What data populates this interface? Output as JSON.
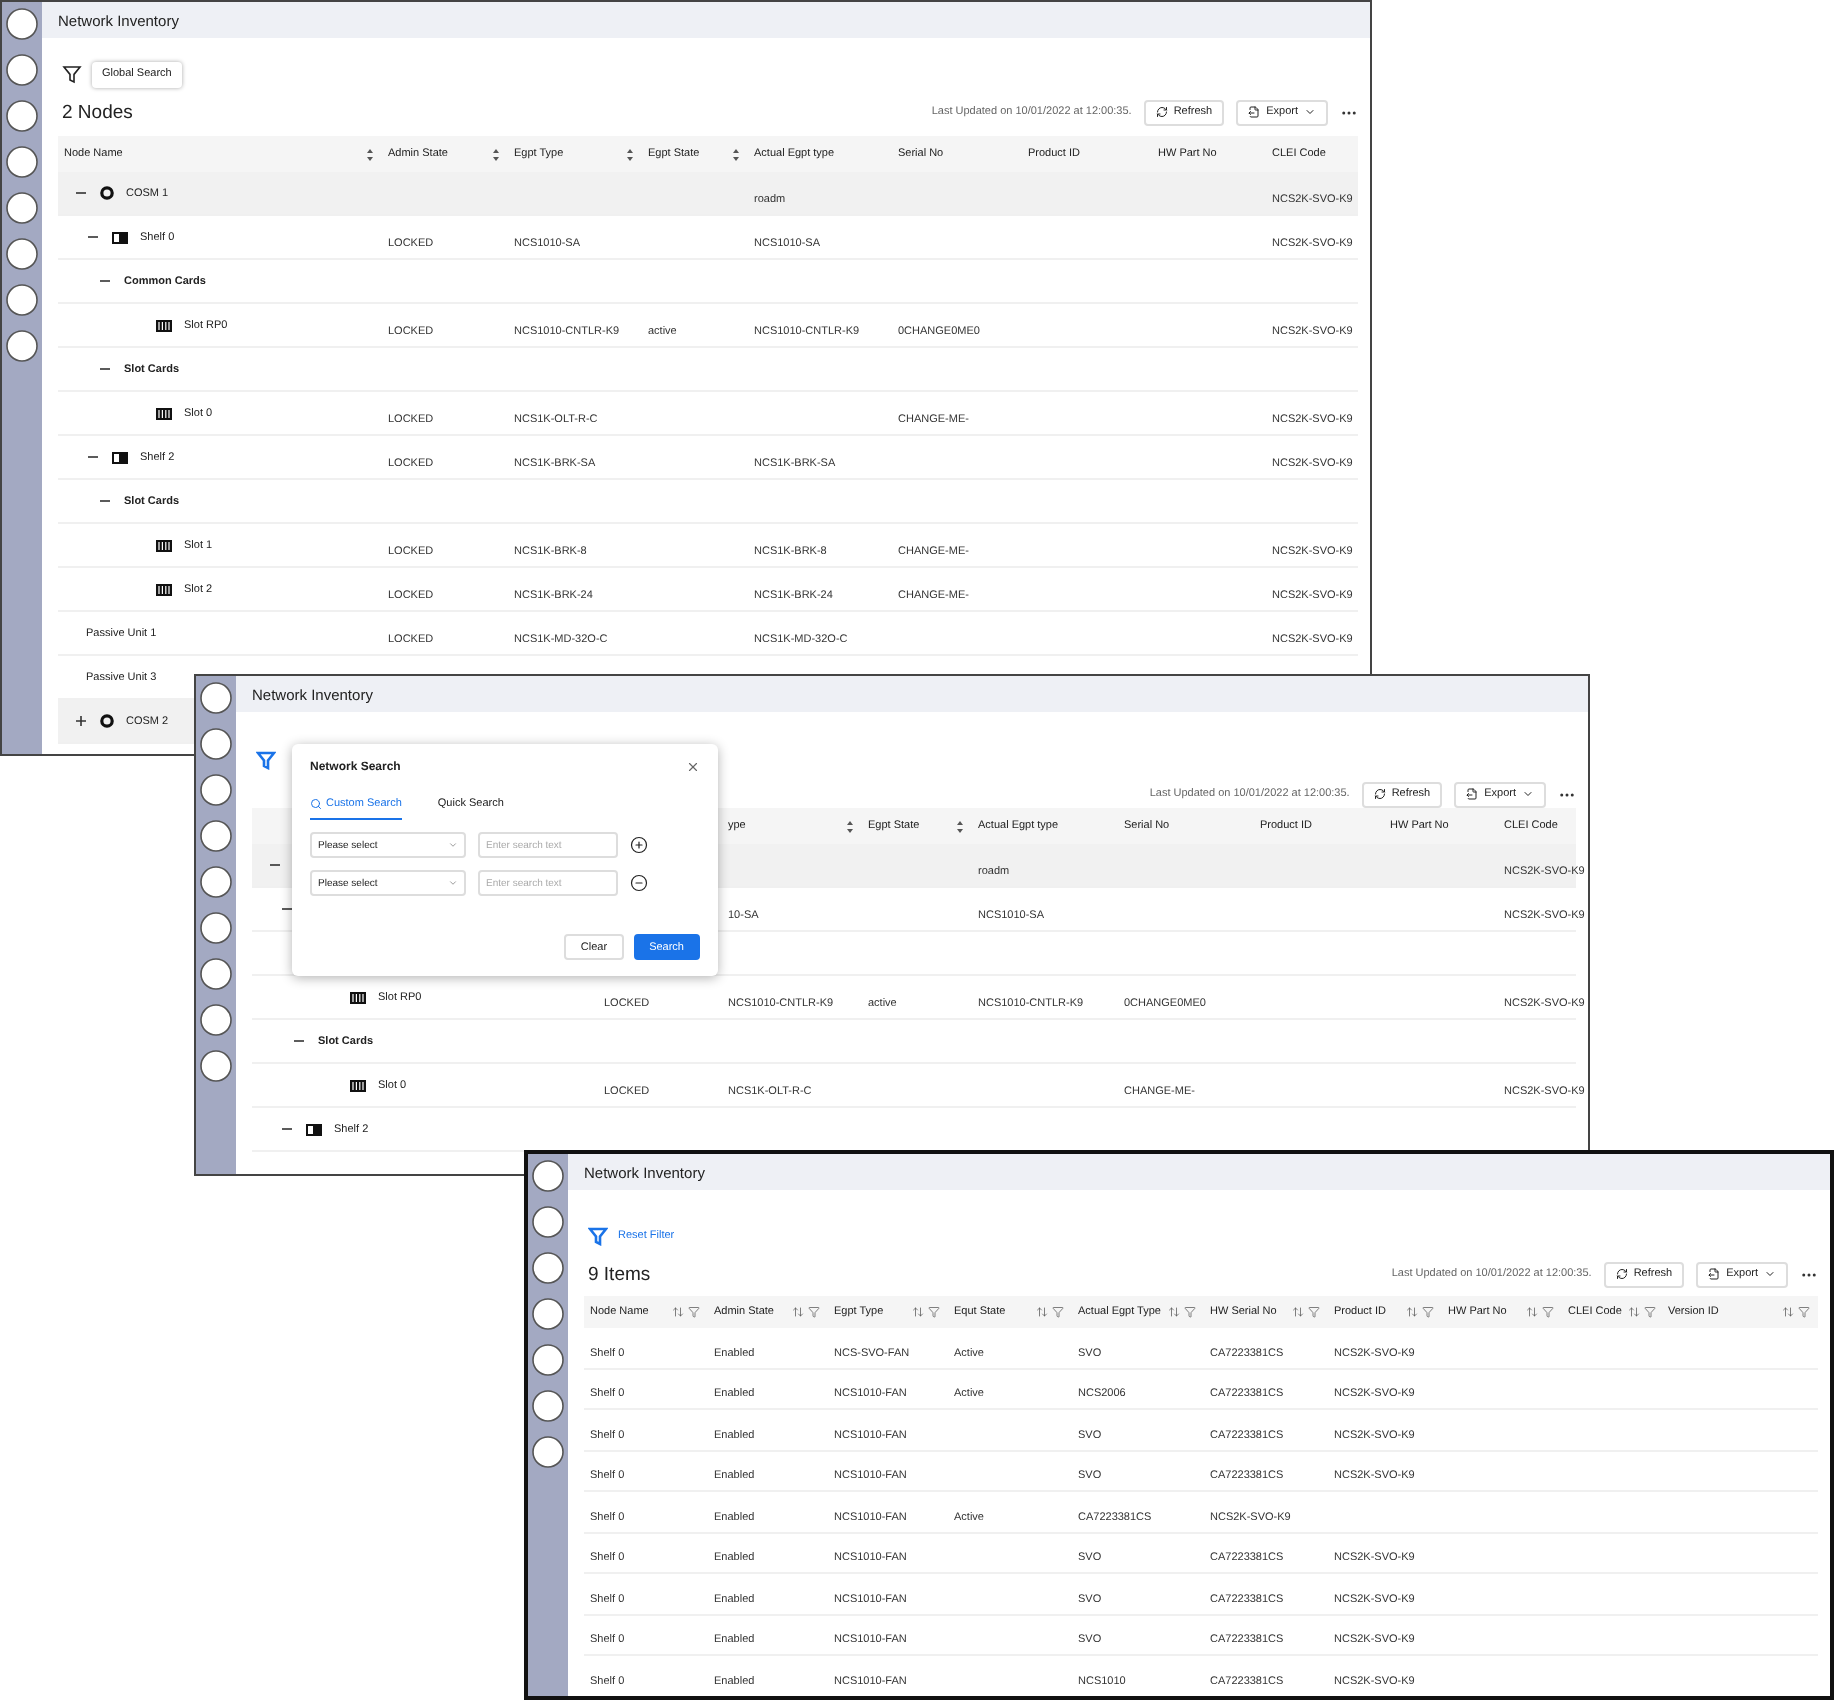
{
  "windows": [
    {
      "kind": "tree",
      "title": "Network Inventory",
      "filter_active": false,
      "filter_action": {
        "kind": "button",
        "label": "Global Search"
      },
      "count": "2 Nodes",
      "last_updated": "Last Updated on 10/01/2022 at 12:00:35.",
      "refresh": "Refresh",
      "export": "Export",
      "columns": [
        {
          "label": "Node Name",
          "sortable": true
        },
        {
          "label": "Admin State",
          "sortable": true
        },
        {
          "label": "Egpt Type",
          "sortable": true
        },
        {
          "label": "Egpt State",
          "sortable": true
        },
        {
          "label": "Actual Egpt type",
          "sortable": false
        },
        {
          "label": "Serial No",
          "sortable": false
        },
        {
          "label": "Product ID",
          "sortable": false
        },
        {
          "label": "HW Part No",
          "sortable": false
        },
        {
          "label": "CLEI Code",
          "sortable": false
        }
      ],
      "rows": [
        {
          "kind": "cosm",
          "name": "COSM 1",
          "expanded": true,
          "cells": [
            null,
            null,
            null,
            null,
            "roadm",
            null,
            null,
            null,
            "NCS2K-SVO-K9"
          ],
          "children": [
            {
              "kind": "shelf",
              "name": "Shelf 0",
              "expanded": true,
              "cells": [
                null,
                "LOCKED",
                "NCS1010-SA",
                null,
                "NCS1010-SA",
                null,
                null,
                null,
                "NCS2K-SVO-K9"
              ],
              "children": [
                {
                  "kind": "group",
                  "name": "Common Cards",
                  "expanded": true,
                  "children": [
                    {
                      "kind": "slot",
                      "name": "Slot RP0",
                      "cells": [
                        null,
                        "LOCKED",
                        "NCS1010-CNTLR-K9",
                        "active",
                        "NCS1010-CNTLR-K9",
                        "0CHANGE0ME0",
                        null,
                        null,
                        "NCS2K-SVO-K9"
                      ]
                    }
                  ]
                },
                {
                  "kind": "group",
                  "name": "Slot Cards",
                  "expanded": true,
                  "children": [
                    {
                      "kind": "slot",
                      "name": "Slot 0",
                      "cells": [
                        null,
                        "LOCKED",
                        "NCS1K-OLT-R-C",
                        null,
                        null,
                        "CHANGE-ME-",
                        null,
                        null,
                        "NCS2K-SVO-K9"
                      ]
                    }
                  ]
                }
              ]
            },
            {
              "kind": "shelf",
              "name": "Shelf 2",
              "expanded": true,
              "cells": [
                null,
                "LOCKED",
                "NCS1K-BRK-SA",
                null,
                "NCS1K-BRK-SA",
                null,
                null,
                null,
                "NCS2K-SVO-K9"
              ],
              "children": [
                {
                  "kind": "group",
                  "name": "Slot Cards",
                  "expanded": true,
                  "children": [
                    {
                      "kind": "slot",
                      "name": "Slot 1",
                      "cells": [
                        null,
                        "LOCKED",
                        "NCS1K-BRK-8",
                        null,
                        "NCS1K-BRK-8",
                        "CHANGE-ME-",
                        null,
                        null,
                        "NCS2K-SVO-K9"
                      ]
                    },
                    {
                      "kind": "slot",
                      "name": "Slot 2",
                      "cells": [
                        null,
                        "LOCKED",
                        "NCS1K-BRK-24",
                        null,
                        "NCS1K-BRK-24",
                        "CHANGE-ME-",
                        null,
                        null,
                        "NCS2K-SVO-K9"
                      ]
                    }
                  ]
                }
              ]
            },
            {
              "kind": "passive",
              "name": "Passive Unit 1",
              "cells": [
                null,
                "LOCKED",
                "NCS1K-MD-32O-C",
                null,
                "NCS1K-MD-32O-C",
                null,
                null,
                null,
                "NCS2K-SVO-K9"
              ]
            },
            {
              "kind": "passive",
              "name": "Passive Unit 3"
            }
          ]
        },
        {
          "kind": "cosm",
          "name": "COSM 2",
          "expanded": false
        }
      ]
    },
    {
      "kind": "tree",
      "title": "Network Inventory",
      "filter_active": true,
      "last_updated": "Last Updated on 10/01/2022 at 12:00:35.",
      "refresh": "Refresh",
      "export": "Export",
      "columns": [
        null,
        null,
        {
          "label": "ype",
          "sortable": true
        },
        {
          "label": "Egpt State",
          "sortable": true
        },
        {
          "label": "Actual Egpt type",
          "sortable": false
        },
        {
          "label": "Serial No",
          "sortable": false
        },
        {
          "label": "Product ID",
          "sortable": false
        },
        {
          "label": "HW Part No",
          "sortable": false
        },
        {
          "label": "CLEI Code",
          "sortable": false
        }
      ],
      "rows": [
        {
          "expanded": true,
          "cells": [
            null,
            null,
            null,
            null,
            "roadm",
            null,
            null,
            null,
            "NCS2K-SVO-K9"
          ],
          "children": [
            {
              "expanded": true,
              "cells": [
                null,
                null,
                "10-SA",
                null,
                "NCS1010-SA",
                null,
                null,
                null,
                "NCS2K-SVO-K9"
              ],
              "children": [
                {
                  "children": [
                    {
                      "kind": "slot",
                      "name": "Slot RP0",
                      "cells": [
                        null,
                        "LOCKED",
                        "NCS1010-CNTLR-K9",
                        "active",
                        "NCS1010-CNTLR-K9",
                        "0CHANGE0ME0",
                        null,
                        null,
                        "NCS2K-SVO-K9"
                      ]
                    }
                  ]
                },
                {
                  "kind": "group",
                  "name": "Slot Cards",
                  "expanded": true,
                  "children": [
                    {
                      "kind": "slot",
                      "name": "Slot 0",
                      "cells": [
                        null,
                        "LOCKED",
                        "NCS1K-OLT-R-C",
                        null,
                        null,
                        "CHANGE-ME-",
                        null,
                        null,
                        "NCS2K-SVO-K9"
                      ]
                    }
                  ]
                }
              ]
            },
            {
              "kind": "shelf",
              "name": "Shelf 2",
              "expanded": true
            }
          ]
        }
      ],
      "dialog": {
        "title": "Network Search",
        "tabs": [
          {
            "label": "Custom Search",
            "selected": true
          },
          {
            "label": "Quick Search",
            "selected": false
          }
        ],
        "criteria": [
          {
            "select": "Please select",
            "placeholder": "Enter search text",
            "kind": "add"
          },
          {
            "select": "Please select",
            "placeholder": "Enter search text",
            "kind": "remove"
          }
        ],
        "buttons": [
          {
            "label": "Clear",
            "kind": "secondary"
          },
          {
            "label": "Search",
            "kind": "primary"
          }
        ]
      }
    },
    {
      "kind": "flat",
      "title": "Network Inventory",
      "filter_active": true,
      "filter_action": {
        "kind": "link",
        "label": "Reset Filter"
      },
      "count": "9 Items",
      "last_updated": "Last Updated on 10/01/2022 at 12:00:35.",
      "refresh": "Refresh",
      "export": "Export",
      "columns": [
        {
          "label": "Node Name",
          "sortable": true,
          "filterable": true
        },
        {
          "label": "Admin State",
          "sortable": true,
          "filterable": true
        },
        {
          "label": "Egpt Type",
          "sortable": true,
          "filterable": true
        },
        {
          "label": "Equt State",
          "sortable": true,
          "filterable": true
        },
        {
          "label": "Actual Egpt Type",
          "sortable": true,
          "filterable": true
        },
        {
          "label": "HW Serial No",
          "sortable": true,
          "filterable": true
        },
        {
          "label": "Product ID",
          "sortable": true,
          "filterable": true
        },
        {
          "label": "HW Part No",
          "sortable": true,
          "filterable": true
        },
        {
          "label": "CLEI Code",
          "sortable": true,
          "filterable": true
        },
        {
          "label": "Version ID",
          "sortable": true,
          "filterable": true
        }
      ],
      "rows": [
        {
          "cells": [
            "Shelf 0",
            "Enabled",
            "NCS-SVO-FAN",
            "Active",
            "SVO",
            "CA7223381CS",
            "NCS2K-SVO-K9",
            null,
            null,
            null
          ]
        },
        {
          "cells": [
            "Shelf 0",
            "Enabled",
            "NCS1010-FAN",
            "Active",
            "NCS2006",
            "CA7223381CS",
            "NCS2K-SVO-K9",
            null,
            null,
            null
          ]
        },
        {
          "cells": [
            "Shelf 0",
            "Enabled",
            "NCS1010-FAN",
            null,
            "SVO",
            "CA7223381CS",
            "NCS2K-SVO-K9",
            null,
            null,
            null
          ]
        },
        {
          "cells": [
            "Shelf 0",
            "Enabled",
            "NCS1010-FAN",
            null,
            "SVO",
            "CA7223381CS",
            "NCS2K-SVO-K9",
            null,
            null,
            null
          ]
        },
        {
          "cells": [
            "Shelf 0",
            "Enabled",
            "NCS1010-FAN",
            "Active",
            "CA7223381CS",
            "NCS2K-SVO-K9",
            null,
            null,
            null,
            null
          ]
        },
        {
          "cells": [
            "Shelf 0",
            "Enabled",
            "NCS1010-FAN",
            null,
            "SVO",
            "CA7223381CS",
            "NCS2K-SVO-K9",
            null,
            null,
            null
          ]
        },
        {
          "cells": [
            "Shelf 0",
            "Enabled",
            "NCS1010-FAN",
            null,
            "SVO",
            "CA7223381CS",
            "NCS2K-SVO-K9",
            null,
            null,
            null
          ]
        },
        {
          "cells": [
            "Shelf 0",
            "Enabled",
            "NCS1010-FAN",
            null,
            "SVO",
            "CA7223381CS",
            "NCS2K-SVO-K9",
            null,
            null,
            null
          ]
        },
        {
          "cells": [
            "Shelf 0",
            "Enabled",
            "NCS1010-FAN",
            null,
            "NCS1010",
            "CA7223381CS",
            "NCS2K-SVO-K9",
            null,
            null,
            null
          ]
        }
      ]
    }
  ]
}
